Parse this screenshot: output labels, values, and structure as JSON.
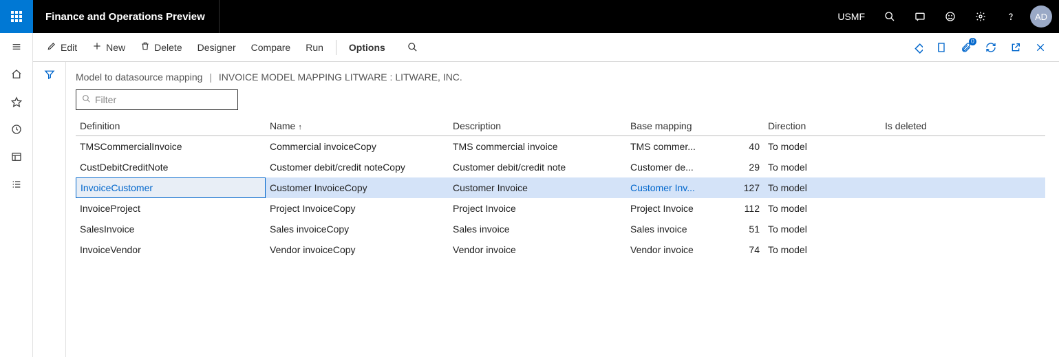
{
  "header": {
    "app_title": "Finance and Operations Preview",
    "company": "USMF",
    "avatar": "AD"
  },
  "commands": {
    "edit": "Edit",
    "new": "New",
    "delete": "Delete",
    "designer": "Designer",
    "compare": "Compare",
    "run": "Run",
    "options": "Options",
    "attachment_count": "0"
  },
  "breadcrumb": {
    "page": "Model to datasource mapping",
    "detail": "INVOICE MODEL MAPPING LITWARE : LITWARE, INC."
  },
  "filter": {
    "placeholder": "Filter"
  },
  "grid": {
    "columns": {
      "definition": "Definition",
      "name": "Name",
      "description": "Description",
      "base": "Base mapping",
      "direction": "Direction",
      "deleted": "Is deleted"
    },
    "rows": [
      {
        "def": "TMSCommercialInvoice",
        "name": "Commercial invoiceCopy",
        "desc": "TMS commercial invoice",
        "base": "TMS commer...",
        "num": "40",
        "dir": "To model",
        "del": "",
        "selected": false
      },
      {
        "def": "CustDebitCreditNote",
        "name": "Customer debit/credit noteCopy",
        "desc": "Customer debit/credit note",
        "base": "Customer de...",
        "num": "29",
        "dir": "To model",
        "del": "",
        "selected": false
      },
      {
        "def": "InvoiceCustomer",
        "name": "Customer InvoiceCopy",
        "desc": "Customer Invoice",
        "base": "Customer Inv...",
        "num": "127",
        "dir": "To model",
        "del": "",
        "selected": true
      },
      {
        "def": "InvoiceProject",
        "name": "Project InvoiceCopy",
        "desc": "Project Invoice",
        "base": "Project Invoice",
        "num": "112",
        "dir": "To model",
        "del": "",
        "selected": false
      },
      {
        "def": "SalesInvoice",
        "name": "Sales invoiceCopy",
        "desc": "Sales invoice",
        "base": "Sales invoice",
        "num": "51",
        "dir": "To model",
        "del": "",
        "selected": false
      },
      {
        "def": "InvoiceVendor",
        "name": "Vendor invoiceCopy",
        "desc": "Vendor invoice",
        "base": "Vendor invoice",
        "num": "74",
        "dir": "To model",
        "del": "",
        "selected": false
      }
    ]
  }
}
